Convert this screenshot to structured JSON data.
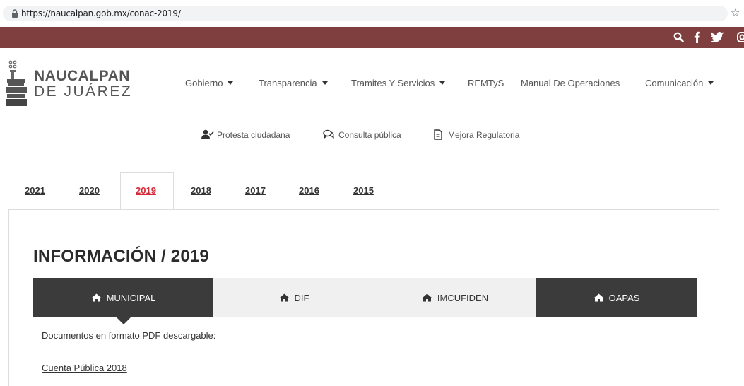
{
  "browser": {
    "url": "https://naucalpan.gob.mx/conac-2019/"
  },
  "social": {
    "icons": [
      "search-icon",
      "facebook-icon",
      "twitter-icon",
      "instagram-icon"
    ],
    "strip_color": "#7f3f3f"
  },
  "header": {
    "logo_line1": "NAUCALPAN",
    "logo_line2": "DE JUÁREZ",
    "nav": [
      {
        "label": "Gobierno",
        "dropdown": true
      },
      {
        "label": "Transparencia",
        "dropdown": true
      },
      {
        "label": "Tramites Y Servicios",
        "dropdown": true
      },
      {
        "label": "REMTyS",
        "dropdown": false
      },
      {
        "label": "Manual De Operaciones",
        "dropdown": false
      },
      {
        "label": "Comunicación",
        "dropdown": true
      }
    ]
  },
  "sub_links": [
    {
      "label": "Protesta ciudadana",
      "icon": "user-check-icon"
    },
    {
      "label": "Consulta pública",
      "icon": "chat-icon"
    },
    {
      "label": "Mejora Regulatoria",
      "icon": "document-icon"
    }
  ],
  "year_tabs": {
    "items": [
      "2021",
      "2020",
      "2019",
      "2018",
      "2017",
      "2016",
      "2015"
    ],
    "active": "2019",
    "active_color": "#d62b3a"
  },
  "panel": {
    "title": "INFORMACIÓN / 2019",
    "entity_tabs": [
      {
        "label": "MUNICIPAL",
        "active": true
      },
      {
        "label": "DIF",
        "active": false
      },
      {
        "label": "IMCUFIDEN",
        "active": false
      },
      {
        "label": "OAPAS",
        "active": false
      }
    ],
    "intro": "Documentos en formato PDF descargable:",
    "documents": [
      "Cuenta Pública 2018"
    ]
  }
}
